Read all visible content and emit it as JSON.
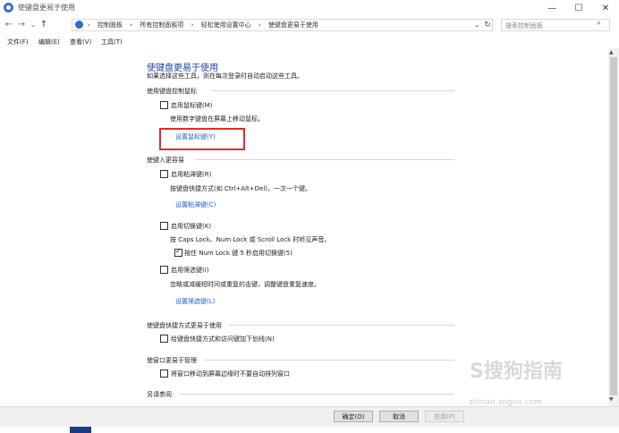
{
  "window": {
    "title": "使键盘更易于使用",
    "minimize_glyph": "—",
    "maximize_glyph": "☐",
    "close_glyph": "✕"
  },
  "nav": {
    "back": "←",
    "forward": "→",
    "dropdown": "⌄",
    "up": "↑",
    "address_dropdown": "⌄",
    "refresh": "↻"
  },
  "breadcrumb": {
    "items": [
      "控制面板",
      "所有控制面板项",
      "轻松使用设置中心",
      "使键盘更易于使用"
    ],
    "separator": "›"
  },
  "search": {
    "placeholder": "搜索控制面板",
    "icon": "search-icon"
  },
  "menu": [
    "文件(F)",
    "编辑(E)",
    "查看(V)",
    "工具(T)"
  ],
  "main": {
    "title": "使键盘更易于使用",
    "subtitle": "如果选择这些工具，则在每次登录时自动启动这些工具。",
    "sections": {
      "mouse": {
        "heading": "使用键盘控制鼠标",
        "checkbox": "启用鼠标键(M)",
        "desc": "使用数字键盘在屏幕上移动鼠标。",
        "link": "设置鼠标键(Y)"
      },
      "easier_typing": {
        "heading": "使键入更容易",
        "sticky_checkbox": "启用粘滞键(R)",
        "sticky_desc": "按键盘快捷方式(如 Ctrl+Alt+Del)，一次一个键。",
        "sticky_link": "设置粘滞键(C)",
        "toggle_checkbox": "启用切换键(K)",
        "toggle_desc": "按 Caps Lock、Num Lock 或 Scroll Lock 时听见声音。",
        "toggle_sub_checkbox": "按住 Num Lock 键 5 秒启用切换键(5)",
        "filter_checkbox": "启用筛选键(I)",
        "filter_desc": "忽略或减缓短时间或重复的击键，调整键盘重复速度。",
        "filter_link": "设置筛选键(L)"
      },
      "shortcuts": {
        "heading": "使键盘快捷方式更易于使用",
        "checkbox": "给键盘快捷方式和访问键加下划线(N)"
      },
      "window_mgmt": {
        "heading": "使窗口更易于管理",
        "checkbox": "将窗口移动到屏幕边缘时不要自动排列窗口"
      },
      "see_also": {
        "heading": "另请参阅"
      }
    }
  },
  "buttons": {
    "ok": "确定(O)",
    "cancel": "取消",
    "apply": "应用(P)"
  },
  "watermark": {
    "logo": "S搜狗指南",
    "url": "zhinan.sogou.com"
  },
  "colors": {
    "title_blue": "#1d3fa8",
    "link_blue": "#1a5fd1",
    "highlight_red": "#e52b2b"
  }
}
